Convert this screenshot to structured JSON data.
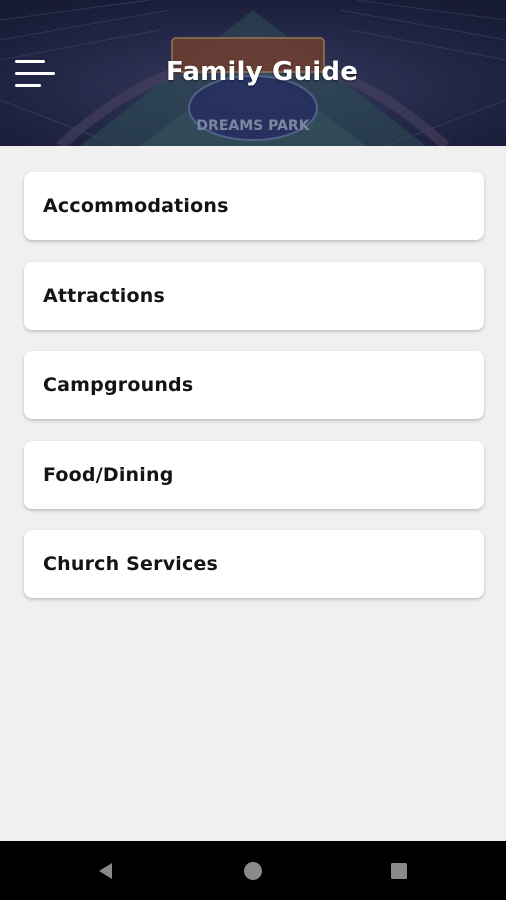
{
  "header": {
    "title": "Family Guide",
    "menu_icon": "hamburger-menu-icon",
    "background": "ballpark-aerial-photo",
    "logo_text": "DREAMS PARK"
  },
  "menu": {
    "items": [
      {
        "label": "Accommodations"
      },
      {
        "label": "Attractions"
      },
      {
        "label": "Campgrounds"
      },
      {
        "label": "Food/Dining"
      },
      {
        "label": "Church Services"
      }
    ]
  },
  "system_nav": {
    "back_icon": "back-triangle-icon",
    "home_icon": "home-circle-icon",
    "recents_icon": "recents-square-icon"
  },
  "colors": {
    "header_bg": "#262b4c",
    "page_bg": "#f0f0f0",
    "card_bg": "#ffffff",
    "text": "#141414",
    "navbar_bg": "#000000"
  }
}
